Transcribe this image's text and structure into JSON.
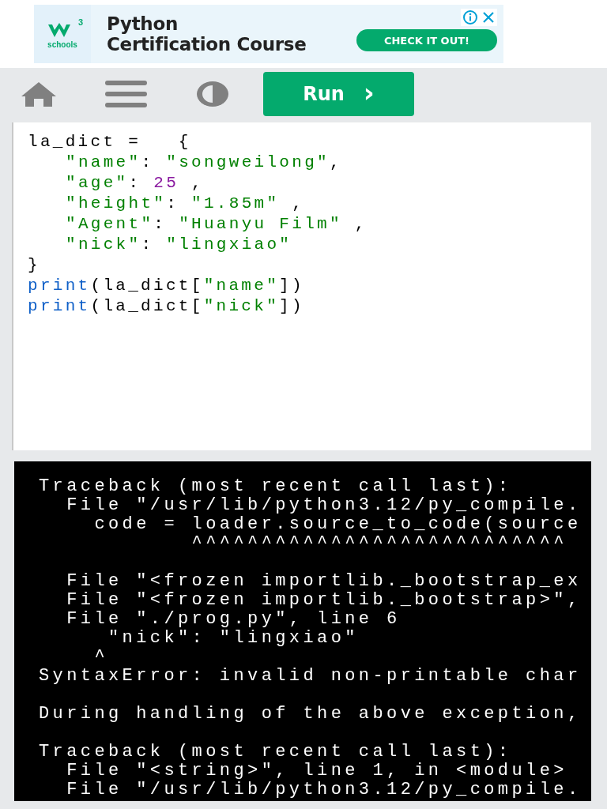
{
  "ad": {
    "logo_sup": "3",
    "logo_text": "schools",
    "headline": [
      "Python",
      "Certification Course"
    ],
    "cta": "CHECK IT OUT!"
  },
  "toolbar": {
    "run_label": "Run",
    "run_glyph": "›"
  },
  "code": [
    {
      "indent": false,
      "tokens": [
        {
          "kind": "plain",
          "text": "la_dict =   {"
        }
      ]
    },
    {
      "indent": true,
      "tokens": [
        {
          "kind": "string",
          "text": "\"name\""
        },
        {
          "kind": "plain",
          "text": ": "
        },
        {
          "kind": "string",
          "text": "\"songweilong\""
        },
        {
          "kind": "plain",
          "text": ","
        }
      ]
    },
    {
      "indent": true,
      "tokens": [
        {
          "kind": "string",
          "text": "\"age\""
        },
        {
          "kind": "plain",
          "text": ": "
        },
        {
          "kind": "number",
          "text": "25"
        },
        {
          "kind": "plain",
          "text": " ,"
        }
      ]
    },
    {
      "indent": true,
      "tokens": [
        {
          "kind": "string",
          "text": "\"height\""
        },
        {
          "kind": "plain",
          "text": ": "
        },
        {
          "kind": "string",
          "text": "\"1.85m\""
        },
        {
          "kind": "plain",
          "text": " ,"
        }
      ]
    },
    {
      "indent": true,
      "tokens": [
        {
          "kind": "string",
          "text": "\"Agent\""
        },
        {
          "kind": "plain",
          "text": ": "
        },
        {
          "kind": "string",
          "text": "\"Huanyu Film\""
        },
        {
          "kind": "plain",
          "text": " ,"
        }
      ]
    },
    {
      "indent": true,
      "tokens": [
        {
          "kind": "string",
          "text": "\"nick\""
        },
        {
          "kind": "plain",
          "text": ": "
        },
        {
          "kind": "string",
          "text": "\"lingxiao\""
        }
      ]
    },
    {
      "indent": false,
      "tokens": [
        {
          "kind": "plain",
          "text": "}"
        }
      ]
    },
    {
      "indent": false,
      "tokens": [
        {
          "kind": "builtin",
          "text": "print"
        },
        {
          "kind": "plain",
          "text": "(la_dict["
        },
        {
          "kind": "string",
          "text": "\"name\""
        },
        {
          "kind": "plain",
          "text": "])"
        }
      ]
    },
    {
      "indent": false,
      "tokens": [
        {
          "kind": "builtin",
          "text": "print"
        },
        {
          "kind": "plain",
          "text": "(la_dict["
        },
        {
          "kind": "string",
          "text": "\"nick\""
        },
        {
          "kind": "plain",
          "text": "])"
        }
      ]
    }
  ],
  "output": [
    [
      "Traceback (most recent call last):",
      "  File \"/usr/lib/python3.12/py_compile.",
      "    code = loader.source_to_code(source",
      "           ^^^^^^^^^^^^^^^^^^^^^^^^^^^"
    ],
    [
      "  File \"<frozen importlib._bootstrap_ex",
      "  File \"<frozen importlib._bootstrap>\",",
      "  File \"./prog.py\", line 6",
      "     \"nick\": \"lingxiao\"",
      "    ^",
      "SyntaxError: invalid non-printable char"
    ],
    [
      "During handling of the above exception,"
    ],
    [
      "Traceback (most recent call last):",
      "  File \"<string>\", line 1, in <module>",
      "  File \"/usr/lib/python3.12/py_compile."
    ]
  ]
}
